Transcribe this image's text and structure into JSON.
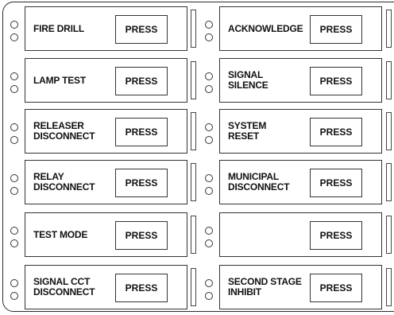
{
  "rows": [
    {
      "left": {
        "label": "FIRE DRILL",
        "button": "PRESS"
      },
      "right": {
        "label": "ACKNOWLEDGE",
        "button": "PRESS"
      }
    },
    {
      "left": {
        "label": "LAMP TEST",
        "button": "PRESS"
      },
      "right": {
        "label": "SIGNAL\nSILENCE",
        "button": "PRESS"
      }
    },
    {
      "left": {
        "label": "RELEASER\nDISCONNECT",
        "button": "PRESS"
      },
      "right": {
        "label": "SYSTEM\nRESET",
        "button": "PRESS"
      }
    },
    {
      "left": {
        "label": "RELAY\nDISCONNECT",
        "button": "PRESS"
      },
      "right": {
        "label": "MUNICIPAL\nDISCONNECT",
        "button": "PRESS"
      }
    },
    {
      "left": {
        "label": "TEST MODE",
        "button": "PRESS"
      },
      "right": {
        "label": "",
        "button": "PRESS"
      }
    },
    {
      "left": {
        "label": "SIGNAL CCT\nDISCONNECT",
        "button": "PRESS"
      },
      "right": {
        "label": "SECOND STAGE\nINHIBIT",
        "button": "PRESS"
      }
    }
  ]
}
